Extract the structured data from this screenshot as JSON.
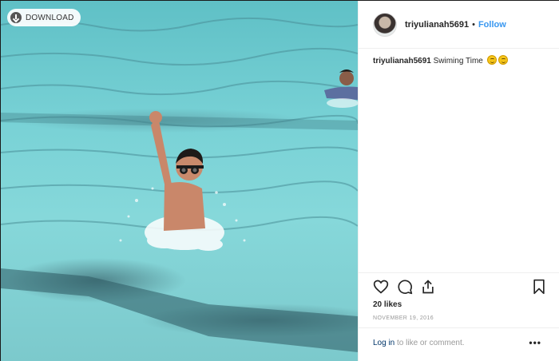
{
  "toolbar": {
    "download_label": "DOWNLOAD"
  },
  "post": {
    "username": "triyulianah5691",
    "separator": "•",
    "follow_label": "Follow",
    "caption": "Swiming Time",
    "likes": "20 likes",
    "date": "NOVEMBER 19, 2016"
  },
  "comment": {
    "login_label": "Log in",
    "prompt": " to like or comment.",
    "more": "•••"
  },
  "icons": [
    "download-icon",
    "heart-icon",
    "comment-icon",
    "share-icon",
    "bookmark-icon",
    "more-icon",
    "grin-emoji-icon"
  ],
  "colors": {
    "link": "#3897f0",
    "login": "#003569",
    "muted": "#999999",
    "pool": "#79d2d6"
  }
}
